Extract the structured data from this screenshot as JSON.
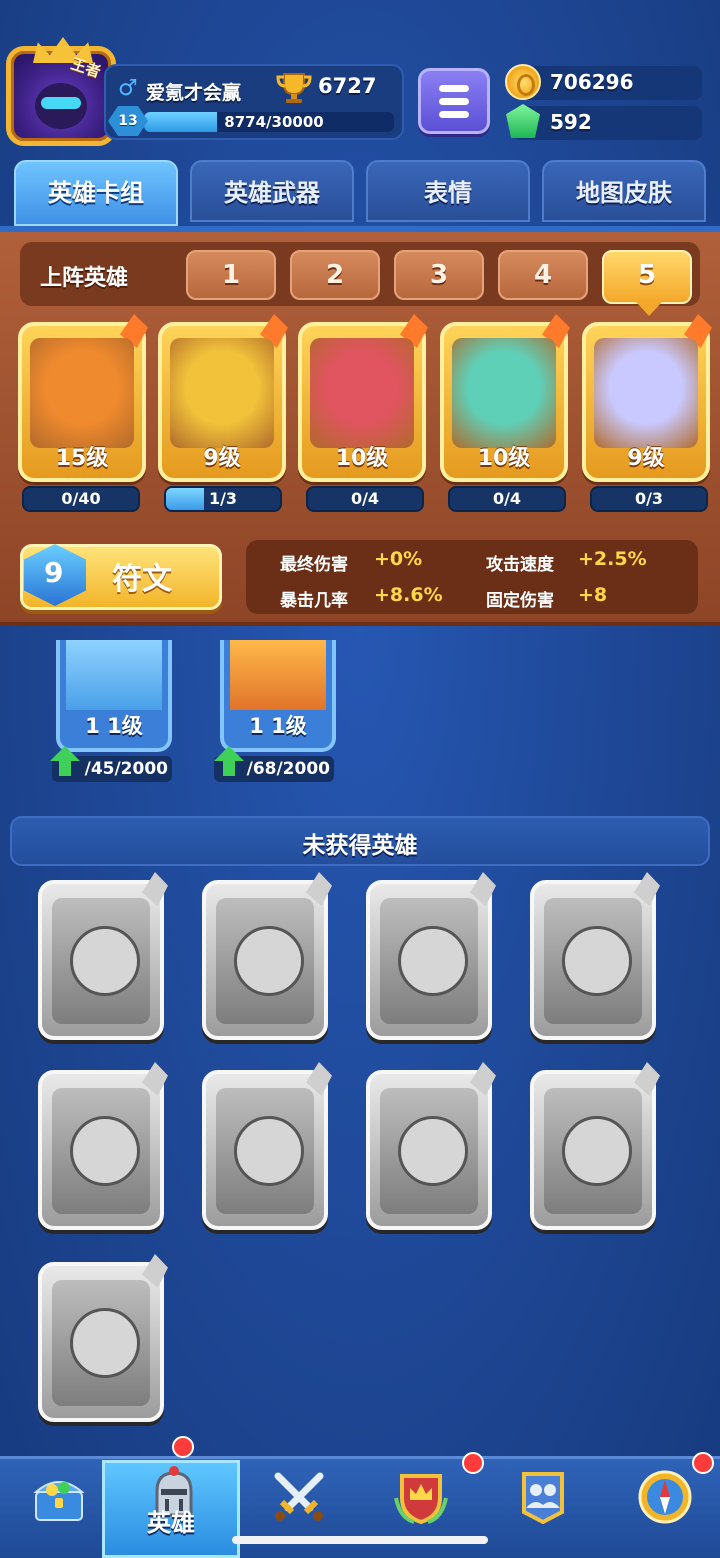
{
  "player": {
    "crown_text": "王者",
    "gender_symbol": "♂",
    "name": "爱氪才会赢",
    "trophies": "6727",
    "level": "13",
    "xp_text": "8774/30000",
    "xp_progress": 0.29
  },
  "currency": {
    "coins": "706296",
    "gems": "592"
  },
  "tabs": [
    {
      "label": "英雄卡组",
      "active": true
    },
    {
      "label": "英雄武器",
      "active": false
    },
    {
      "label": "表情",
      "active": false
    },
    {
      "label": "地图皮肤",
      "active": false
    }
  ],
  "deck": {
    "label": "上阵英雄",
    "slots": [
      "1",
      "2",
      "3",
      "4",
      "5"
    ],
    "selected_slot": "5",
    "heroes": [
      {
        "level": "15级",
        "progress": "0/40",
        "fill": 0.0,
        "color": "#f08a2e"
      },
      {
        "level": "9级",
        "progress": "1/3",
        "fill": 0.33,
        "color": "#f2c33a"
      },
      {
        "level": "10级",
        "progress": "0/4",
        "fill": 0.0,
        "color": "#e0555f"
      },
      {
        "level": "10级",
        "progress": "0/4",
        "fill": 0.0,
        "color": "#5fd0b8"
      },
      {
        "level": "9级",
        "progress": "0/3",
        "fill": 0.0,
        "color": "#c9c9ff"
      }
    ],
    "rune_label": "符文",
    "stats": [
      {
        "label": "最终伤害",
        "value": "+0%"
      },
      {
        "label": "攻击速度",
        "value": "+2.5%"
      },
      {
        "label": "暴击几率",
        "value": "+8.6%"
      },
      {
        "label": "固定伤害",
        "value": "+8"
      }
    ]
  },
  "owned_heroes": [
    {
      "level": "1 1级",
      "progress": "/45/2000"
    },
    {
      "level": "1 1级",
      "progress": "/68/2000"
    }
  ],
  "locked_section": {
    "title": "未获得英雄",
    "count": 9
  },
  "bottom_nav": [
    {
      "name": "shop",
      "label": ""
    },
    {
      "name": "heroes",
      "label": "英雄",
      "active": true
    },
    {
      "name": "battle",
      "label": ""
    },
    {
      "name": "clan",
      "label": ""
    },
    {
      "name": "social",
      "label": ""
    },
    {
      "name": "explore",
      "label": ""
    }
  ]
}
